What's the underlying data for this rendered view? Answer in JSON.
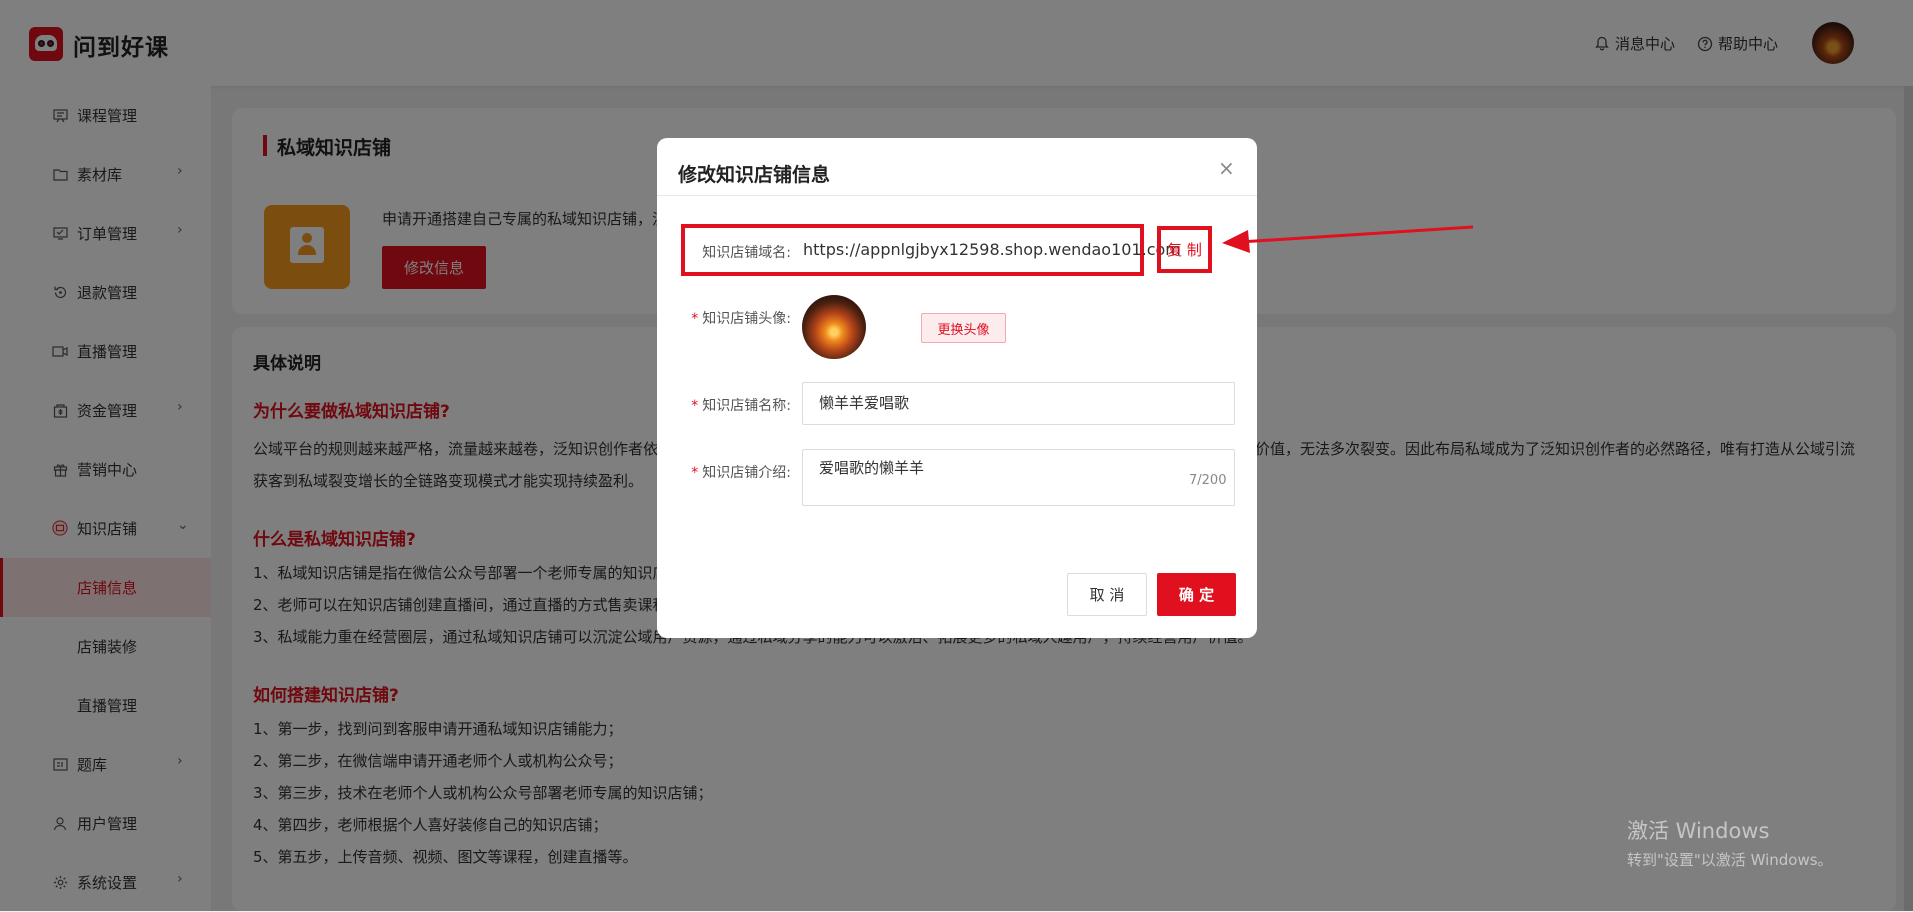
{
  "header": {
    "logo_text": "问到好课",
    "messages": "消息中心",
    "help": "帮助中心"
  },
  "sidebar": {
    "items": [
      {
        "label": "课程管理",
        "icon": "course-icon"
      },
      {
        "label": "素材库",
        "icon": "folder-icon"
      },
      {
        "label": "订单管理",
        "icon": "order-icon"
      },
      {
        "label": "退款管理",
        "icon": "refund-icon"
      },
      {
        "label": "直播管理",
        "icon": "live-icon"
      },
      {
        "label": "资金管理",
        "icon": "fund-icon"
      },
      {
        "label": "营销中心",
        "icon": "gift-icon"
      },
      {
        "label": "知识店铺",
        "icon": "shop-icon"
      },
      {
        "label": "店铺信息"
      },
      {
        "label": "店铺装修"
      },
      {
        "label": "直播管理"
      },
      {
        "label": "题库",
        "icon": "question-bank-icon"
      },
      {
        "label": "用户管理",
        "icon": "user-icon"
      },
      {
        "label": "系统设置",
        "icon": "settings-icon"
      }
    ]
  },
  "main": {
    "section_title": "私域知识店铺",
    "shop_desc": "申请开通搭建自己专属的私域知识店铺，沉",
    "edit_button": "修改信息",
    "details_title": "具体说明",
    "q1": "为什么要做私域知识店铺?",
    "q1_p1a": "公域平台的规则越来越严格，流量越来越卷，泛知识创作者依",
    "q1_p1b": "价值，无法多次裂变。因此布局私域成为了泛知识创作者的必然路径，唯有打造从公域引流",
    "q1_p2": "获客到私域裂变增长的全链路变现模式才能实现持续盈利。",
    "q2": "什么是私域知识店铺?",
    "q2_l1": "1、私域知识店铺是指在微信公众号部署一个老师专属的知识店",
    "q2_l2": "2、老师可以在知识店铺创建直播间，通过直播的方式售卖课程",
    "q2_l3a": "3、私域能力重在经营圈层，通过私域知识店铺可以沉淀公域用户资源，通过私域分享的能力可以激活、拓展更多的私域人趣用户，持续经营用户价值。",
    "q3": "如何搭建知识店铺?",
    "steps": [
      "1、第一步，找到问到客服申请开通私域知识店铺能力；",
      "2、第二步，在微信端申请开通老师个人或机构公众号；",
      "3、第三步，技术在老师个人或机构公众号部署老师专属的知识店铺；",
      "4、第四步，老师根据个人喜好装修自己的知识店铺；",
      "5、第五步，上传音频、视频、图文等课程，创建直播等。"
    ]
  },
  "modal": {
    "title": "修改知识店铺信息",
    "domain_label": "知识店铺域名:",
    "domain_value": "https://appnlgjbyx12598.shop.wendao101.com",
    "copy_label": "复 制",
    "avatar_label": "知识店铺头像:",
    "change_avatar": "更换头像",
    "name_label": "知识店铺名称:",
    "name_value": "懒羊羊爱唱歌",
    "intro_label": "知识店铺介绍:",
    "intro_value": "爱唱歌的懒羊羊",
    "intro_counter": "7/200",
    "cancel": "取 消",
    "confirm": "确 定"
  },
  "watermark": {
    "line1": "激活 Windows",
    "line2": "转到\"设置\"以激活 Windows。"
  },
  "colors": {
    "brand_red": "#e0101e",
    "shop_orange": "#f79b1e"
  }
}
